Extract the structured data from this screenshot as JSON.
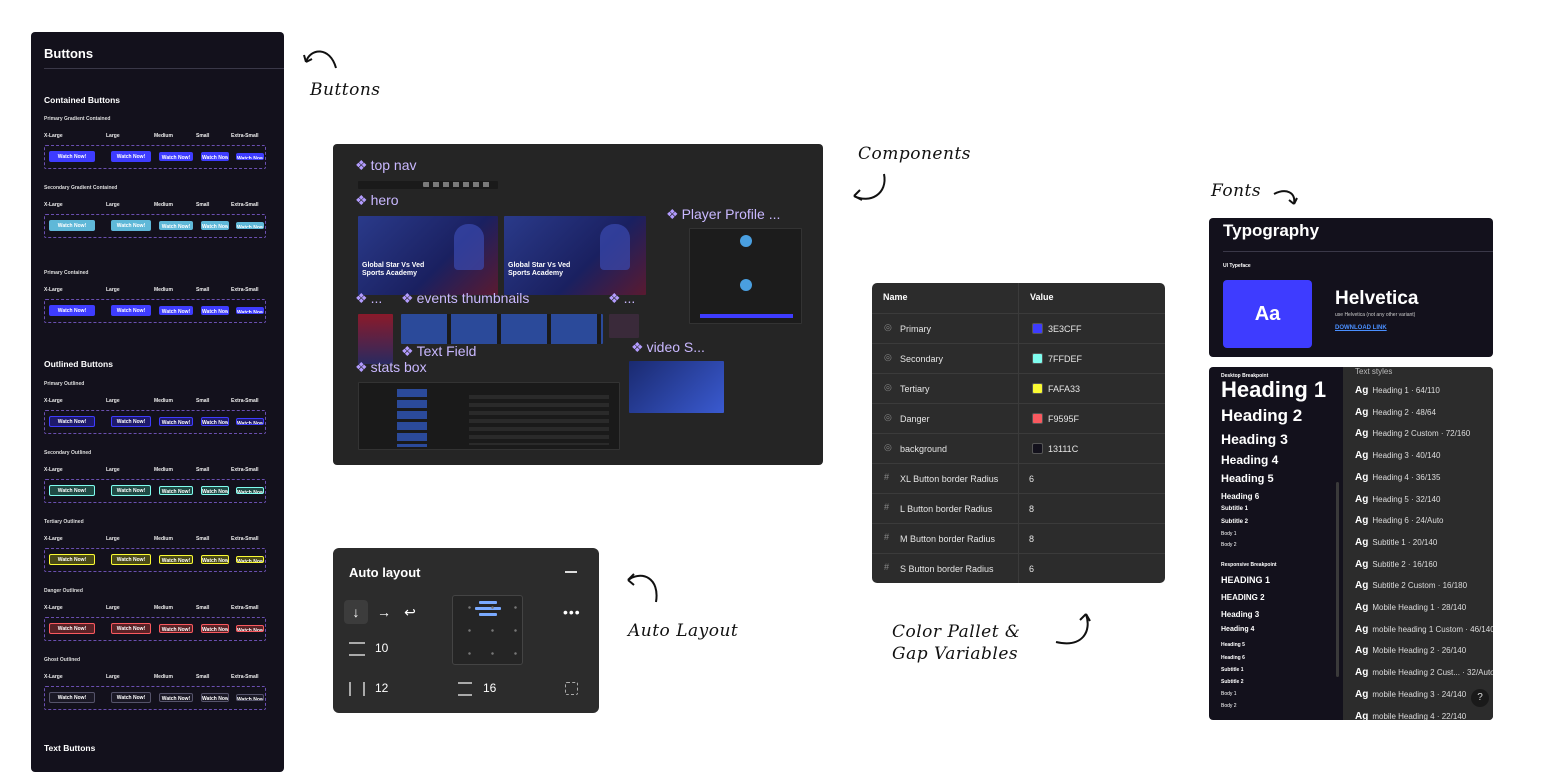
{
  "annotations": {
    "buttons": "Buttons",
    "components": "Components",
    "fonts": "Fonts",
    "auto_layout": "Auto Layout",
    "color_pallet_line1": "Color Pallet &",
    "color_pallet_line2": "Gap Variables"
  },
  "buttons_panel": {
    "title": "Buttons",
    "contained_heading": "Contained Buttons",
    "outlined_heading": "Outlined Buttons",
    "text_heading": "Text Buttons",
    "sizes": [
      "X-Large",
      "Large",
      "Medium",
      "Small",
      "Extra-Small"
    ],
    "button_label": "Watch Now!",
    "groups": [
      {
        "label": "Primary Gradient Contained",
        "fill": "#3e3cff",
        "border": "#3e3cff"
      },
      {
        "label": "Secondary Gradient Contained",
        "fill": "#5fb8d8",
        "border": "#5fb8d8"
      },
      {
        "label": "Primary Contained",
        "fill": "#3e3cff",
        "border": "#3e3cff"
      },
      {
        "label": "Primary Outlined",
        "fill": "#1e1a6b",
        "border": "#3e3cff"
      },
      {
        "label": "Secondary Outlined",
        "fill": "#1f4a44",
        "border": "#7ffdef"
      },
      {
        "label": "Tertiary Outlined",
        "fill": "#4a4a16",
        "border": "#fafa33"
      },
      {
        "label": "Danger Outlined",
        "fill": "#5a2226",
        "border": "#f9595f"
      },
      {
        "label": "Ghost Outlined",
        "fill": "#1b1926",
        "border": "#55536a"
      }
    ]
  },
  "components": {
    "labels": {
      "top_nav": "top nav",
      "hero": "hero",
      "player_profile": "Player Profile ...",
      "events_ellipsis_left": "...",
      "events_thumbnails": "events thumbnails",
      "events_ellipsis_right": "...",
      "text_field": "Text Field",
      "stats_box": "stats box",
      "video": "video S..."
    },
    "hero_text": "Global Star Vs Ved Sports Academy"
  },
  "auto_layout": {
    "title": "Auto layout",
    "gap": "10",
    "padding_h": "12",
    "padding_v": "16"
  },
  "variables": {
    "headers": {
      "name": "Name",
      "value": "Value"
    },
    "colors": [
      {
        "name": "Primary",
        "hex": "3E3CFF",
        "swatch": "#3e3cff"
      },
      {
        "name": "Secondary",
        "hex": "7FFDEF",
        "swatch": "#7ffdef"
      },
      {
        "name": "Tertiary",
        "hex": "FAFA33",
        "swatch": "#fafa33"
      },
      {
        "name": "Danger",
        "hex": "F9595F",
        "swatch": "#f9595f"
      },
      {
        "name": "background",
        "hex": "13111C",
        "swatch": "#13111c"
      }
    ],
    "numbers": [
      {
        "name": "XL Button border Radius",
        "value": "6"
      },
      {
        "name": "L Button border Radius",
        "value": "8"
      },
      {
        "name": "M Button border Radius",
        "value": "8"
      },
      {
        "name": "S Button border Radius",
        "value": "6"
      }
    ]
  },
  "typography": {
    "title": "Typography",
    "ui_typeface_label": "UI Typeface",
    "sample": "Aa",
    "family": "Helvetica",
    "note": "use Helvetica (not any other variant)",
    "download": "DOWNLOAD LINK",
    "accent": "#3e3cff"
  },
  "text_styles": {
    "desktop_label": "Desktop Breakpoint",
    "responsive_label": "Responsive Breakpoint",
    "desktop": [
      "Heading 1",
      "Heading 2",
      "Heading 3",
      "Heading 4",
      "Heading 5",
      "Heading 6",
      "Subtitle 1",
      "Subtitle 2",
      "Body 1",
      "Body 2"
    ],
    "responsive": [
      "HEADING 1",
      "HEADING 2",
      "Heading 3",
      "Heading 4",
      "Heading 5",
      "Heading 6",
      "Subtitle 1",
      "Subtitle 2",
      "Body 1",
      "Body 2"
    ],
    "list_title": "Text styles",
    "ag": "Ag",
    "styles": [
      "Heading 1 · 64/110",
      "Heading 2 · 48/64",
      "Heading 2 Custom · 72/160",
      "Heading 3 · 40/140",
      "Heading 4 · 36/135",
      "Heading 5 · 32/140",
      "Heading 6 · 24/Auto",
      "Subtitle 1 · 20/140",
      "Subtitle 2 · 16/160",
      "Subtitle 2 Custom · 16/180",
      "Mobile Heading 1 · 28/140",
      "mobile heading 1 Custom · 46/140",
      "Mobile Heading 2 · 26/140",
      "mobile Heading 2 Cust... · 32/Auto",
      "mobile Heading 3 · 24/140",
      "mobile Heading 4 · 22/140"
    ],
    "help": "?"
  }
}
